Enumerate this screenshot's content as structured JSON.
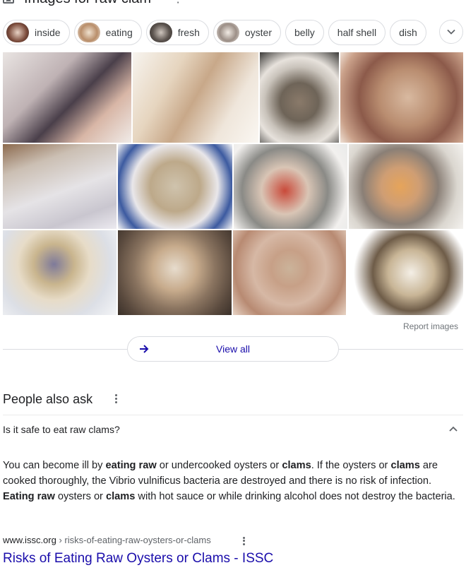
{
  "header": {
    "title": "Images for raw clam",
    "more_glyph": "⋮"
  },
  "chips": [
    {
      "label": "inside",
      "thumb": true,
      "color": "#7a4a3a"
    },
    {
      "label": "eating",
      "thumb": true,
      "color": "#b98e6a"
    },
    {
      "label": "fresh",
      "thumb": true,
      "color": "#5d5550"
    },
    {
      "label": "oyster",
      "thumb": true,
      "color": "#9c8f87"
    },
    {
      "label": "belly",
      "thumb": false
    },
    {
      "label": "half shell",
      "thumb": false
    },
    {
      "label": "dish",
      "thumb": false
    }
  ],
  "images": [
    {
      "alt": "clams on ice",
      "bg": "linear-gradient(135deg,#e9e4e2 0%,#bfb2b4 35%,#4a3f4a 55%,#d8b6a6 75%,#f0ebe8 100%)"
    },
    {
      "alt": "open clams on white",
      "bg": "linear-gradient(120deg,#f7f4ef 0%,#e6d5bf 30%,#c8a889 50%,#efe6db 75%,#faf7f2 100%)"
    },
    {
      "alt": "clams on plate with lemon",
      "bg": "radial-gradient(circle at 50% 55%,#8a7a6a 0%,#6e6458 30%,#c9c3bb 55%,#e7e2dc 70%,#3b3a38 100%)"
    },
    {
      "alt": "close-up raw clam",
      "bg": "radial-gradient(circle at 55% 50%,#d8b9a0 0%,#b98d70 35%,#8c5a4a 60%,#caa18a 85%,#efe0d4 100%)"
    },
    {
      "alt": "razor clam on ice",
      "bg": "linear-gradient(160deg,#8c6a4e 0%,#cbbfb3 25%,#e5e3e6 55%,#c9c6cf 80%,#eceaf0 100%)"
    },
    {
      "alt": "clams on blue plate",
      "bg": "radial-gradient(circle at 50% 50%,#cfc3ad 0%,#bda98a 35%,#e9e7ea 60%,#3c5aa0 80%,#f3f3f5 100%)"
    },
    {
      "alt": "clams with red sauce",
      "bg": "radial-gradient(circle at 45% 55%,#c94a3a 0%,#d9c5b5 30%,#8a8a86 55%,#f2f0ee 80%,#e9eae9 100%)"
    },
    {
      "alt": "open clams with orange meat",
      "bg": "radial-gradient(circle at 45% 50%,#e6a45a 0%,#cf9e74 25%,#8a7f76 50%,#dbd7d0 75%,#f4f2ef 100%)"
    },
    {
      "alt": "clams on plate with lemon wedge",
      "bg": "radial-gradient(circle at 45% 40%,#7e7a9a 0%,#c9b58e 25%,#e7dcc8 45%,#dcdfe6 70%,#f4f5f7 100%)"
    },
    {
      "alt": "pile of clams",
      "bg": "radial-gradient(circle at 50% 45%,#e7dccd 0%,#c7ab8c 30%,#8a7460 55%,#5a4a3e 80%,#3a3029 100%)"
    },
    {
      "alt": "hand holding clam",
      "bg": "radial-gradient(circle at 50% 45%,#cbb39a 0%,#c7a087 25%,#d6b8a5 50%,#b88a72 75%,#e7d3c4 100%)"
    },
    {
      "alt": "clam on white background",
      "bg": "radial-gradient(circle at 55% 50%,#f4efe6 0%,#c8b596 30%,#6e5c48 50%,#ffffff 75%,#ffffff 100%)"
    }
  ],
  "report_images": "Report images",
  "view_all": "View all",
  "paa": {
    "title": "People also ask",
    "question": "Is it safe to eat raw clams?",
    "answer": [
      {
        "t": "You can become ill by ",
        "b": false
      },
      {
        "t": "eating raw",
        "b": true
      },
      {
        "t": " or undercooked oysters or ",
        "b": false
      },
      {
        "t": "clams",
        "b": true
      },
      {
        "t": ". If the oysters or ",
        "b": false
      },
      {
        "t": "clams",
        "b": true
      },
      {
        "t": " are cooked thoroughly, the Vibrio vulnificus bacteria are destroyed and there is no risk of infection. ",
        "b": false
      },
      {
        "t": "Eating raw",
        "b": true
      },
      {
        "t": " oysters or ",
        "b": false
      },
      {
        "t": "clams",
        "b": true
      },
      {
        "t": " with hot sauce or while drinking alcohol does not destroy the bacteria.",
        "b": false
      }
    ],
    "source_domain": "www.issc.org",
    "source_path": " › risks-of-eating-raw-oysters-or-clams",
    "link_title": "Risks of Eating Raw Oysters or Clams - ISSC"
  },
  "colors": {
    "link": "#1a0dab",
    "border": "#dadce0",
    "muted": "#70757a"
  }
}
